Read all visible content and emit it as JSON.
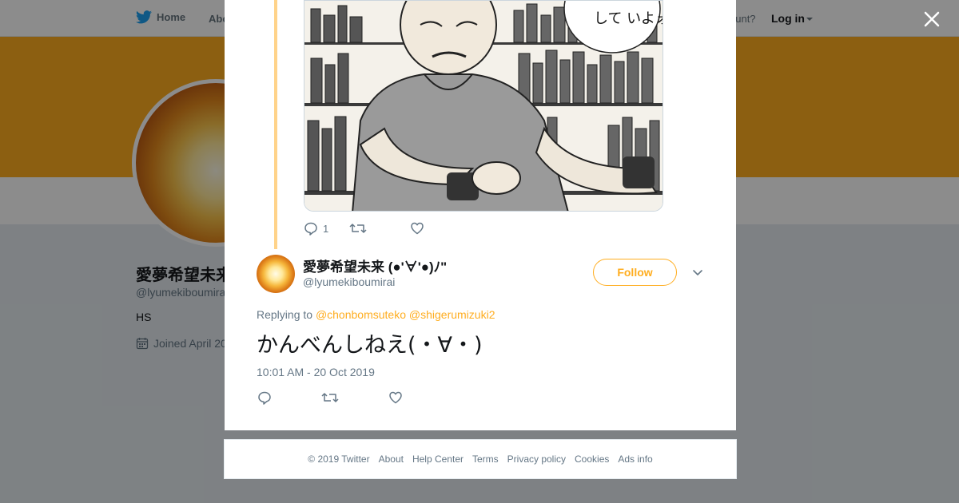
{
  "nav": {
    "home": "Home",
    "about": "Abo",
    "account": "ccount?",
    "login": "Log in"
  },
  "profile": {
    "name": "愛夢希望未来",
    "handle": "@lyumekiboumirai",
    "bio": "HS",
    "joined": "Joined April 20"
  },
  "colors": {
    "accent": "#ffad1f",
    "thread_line": "#ffd38a"
  },
  "prev_tweet": {
    "reply_count": "1",
    "icons": [
      "reply-icon",
      "retweet-icon",
      "like-icon"
    ],
    "image_text": "して いよォ"
  },
  "tweet": {
    "name": "愛夢希望未来 (●'∀'●)ﾉ\"",
    "handle": "@lyumekiboumirai",
    "follow_label": "Follow",
    "replying_prefix": "Replying to",
    "mention_1": "@chonbomsuteko",
    "mention_2": "@shigerumizuki2",
    "text": "かんべんしねえ(・∀・)",
    "time": "10:01 AM - 20 Oct 2019"
  },
  "footer": {
    "copyright": "© 2019 Twitter",
    "about": "About",
    "help": "Help Center",
    "terms": "Terms",
    "privacy": "Privacy policy",
    "cookies": "Cookies",
    "ads": "Ads info"
  }
}
